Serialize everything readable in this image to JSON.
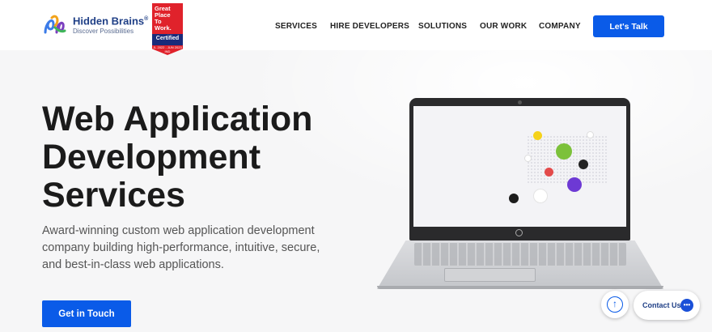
{
  "header": {
    "logo_name": "Hidden Brains",
    "logo_reg": "®",
    "logo_tagline": "Discover Possibilities",
    "badge": {
      "line1": "Great",
      "line2": "Place",
      "line3": "To",
      "line4": "Work.",
      "certified": "Certified",
      "small": "JL 2022 - JUN 2023 IND"
    },
    "nav": [
      {
        "label": "SERVICES"
      },
      {
        "label": "HIRE DEVELOPERS"
      },
      {
        "label": "SOLUTIONS"
      },
      {
        "label": "OUR WORK"
      },
      {
        "label": "COMPANY"
      }
    ],
    "cta": "Let's Talk"
  },
  "hero": {
    "title_line1": "Web Application",
    "title_line2": "Development",
    "title_line3": "Services",
    "subtitle": "Award-winning custom web application development company building high-performance, intuitive, secure, and best-in-class web applications.",
    "cta": "Get in Touch"
  },
  "floating": {
    "scroll_icon": "arrow-up-icon",
    "contact_label": "Contact Us",
    "chat_icon": "chat-icon"
  },
  "colors": {
    "primary": "#0a5be8",
    "brand_navy": "#1f3f86",
    "badge_red": "#e0222b"
  }
}
